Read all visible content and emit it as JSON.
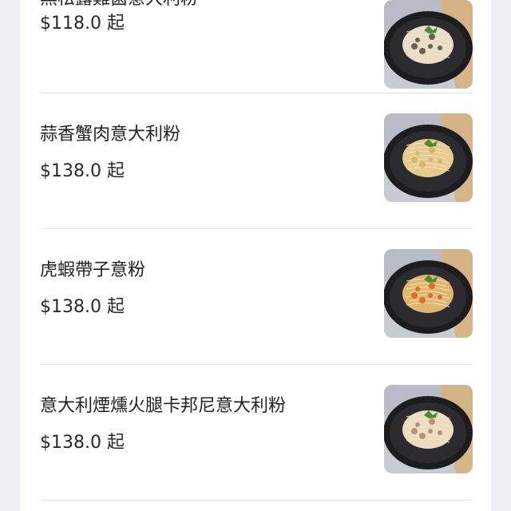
{
  "menu": {
    "items": [
      {
        "name": "黑松露雞菌意大利粉",
        "price": "$118.0 起",
        "image": "pasta-cream-mushroom-photo",
        "sauce_color": "#e8ddc6",
        "topping_color": "#6f5d55"
      },
      {
        "name": "蒜香蟹肉意大利粉",
        "price": "$138.0 起",
        "image": "pasta-garlic-crab-photo",
        "sauce_color": "#e6cb8c",
        "topping_color": "#d8b56a"
      },
      {
        "name": "虎蝦帶子意粉",
        "price": "$138.0 起",
        "image": "pasta-prawn-scallop-photo",
        "sauce_color": "#e0b66e",
        "topping_color": "#e2682e"
      },
      {
        "name": "意大利煙燻火腿卡邦尼意大利粉",
        "price": "$138.0 起",
        "image": "pasta-carbonara-ham-photo",
        "sauce_color": "#ecdcc0",
        "topping_color": "#b99079"
      }
    ]
  },
  "colors": {
    "background": "#f0f0f4",
    "card": "#ffffff",
    "divider": "#e3e3e3",
    "plate": "#1d1d1f",
    "herb": "#4e8a2f"
  }
}
